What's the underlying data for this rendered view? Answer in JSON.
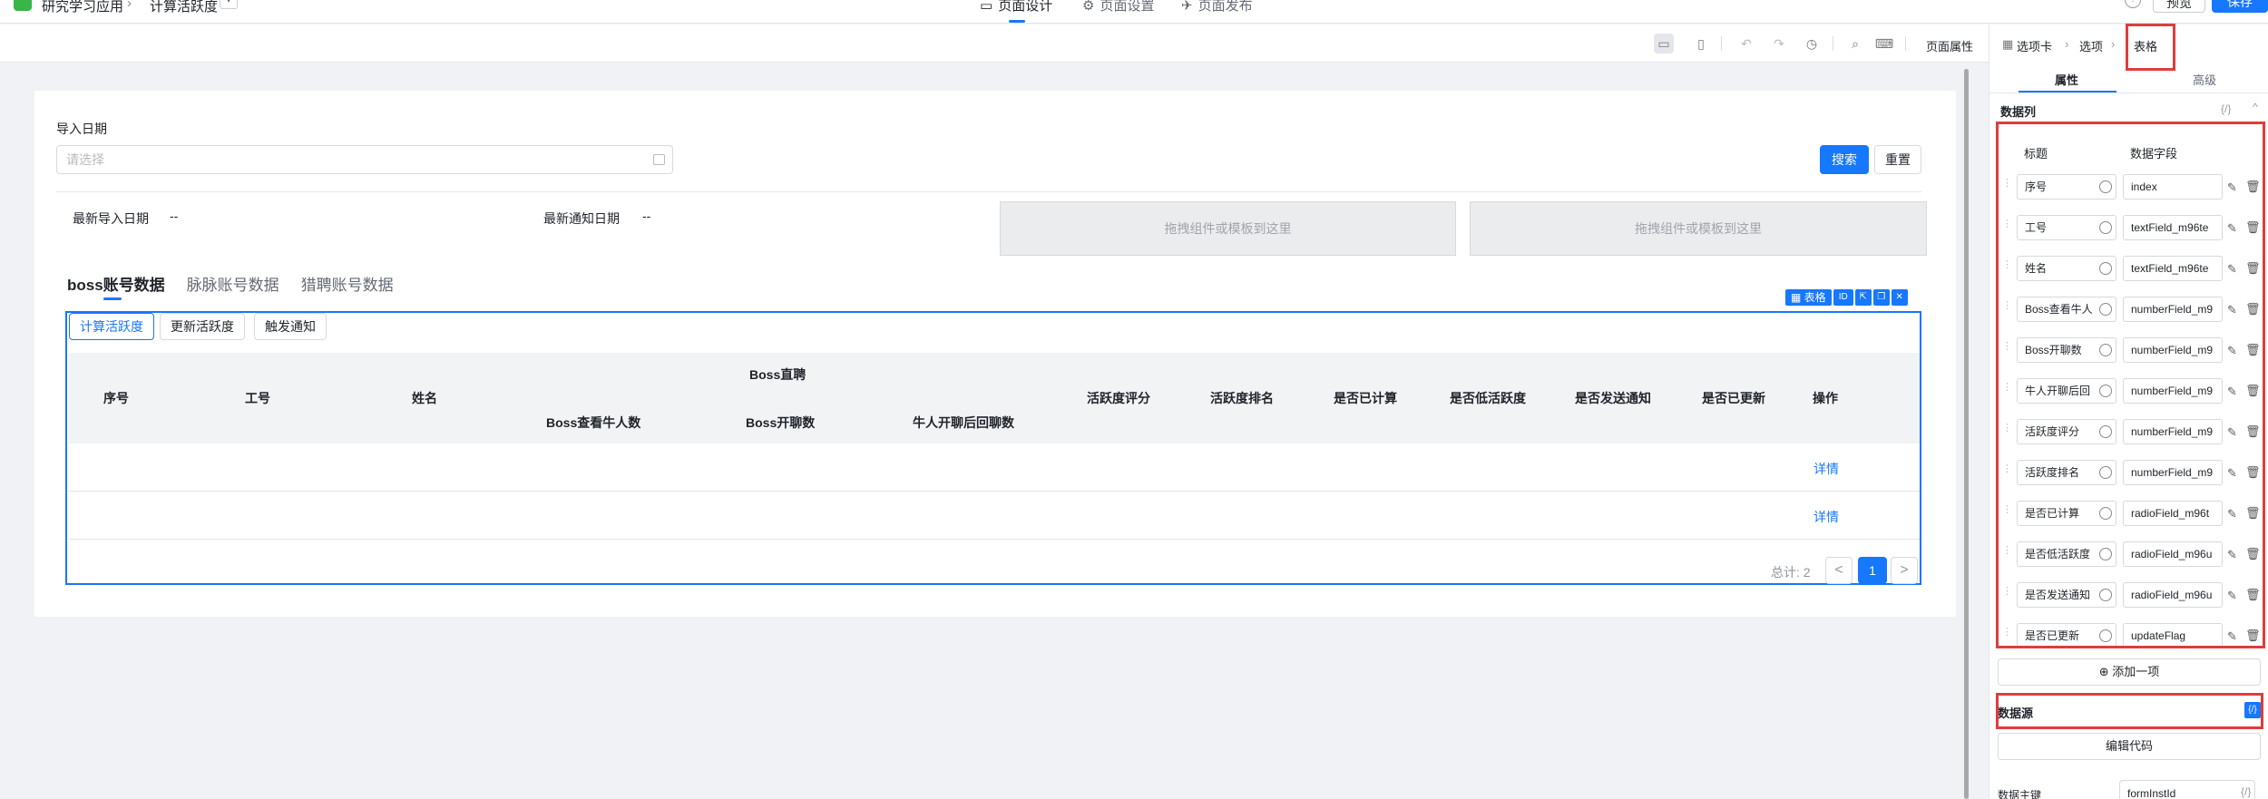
{
  "app": {
    "name": "研究学习应用",
    "page": "计算活跃度"
  },
  "top_tabs": [
    {
      "label": "页面设计"
    },
    {
      "label": "页面设置"
    },
    {
      "label": "页面发布"
    }
  ],
  "top_actions": {
    "help": "?",
    "preview": "预览",
    "save": "保存"
  },
  "toolbar": {
    "page_props": "页面属性"
  },
  "filter": {
    "label": "导入日期",
    "placeholder": "请选择",
    "search": "搜索",
    "reset": "重置"
  },
  "info": {
    "latest_import_label": "最新导入日期",
    "latest_import_value": "--",
    "latest_notify_label": "最新通知日期",
    "latest_notify_value": "--",
    "dropzone": "拖拽组件或模板到这里"
  },
  "account_tabs": [
    "boss账号数据",
    "脉脉账号数据",
    "猎聘账号数据"
  ],
  "widget": {
    "badge": "表格",
    "id_label": "ID"
  },
  "actions": [
    "计算活跃度",
    "更新活跃度",
    "触发通知"
  ],
  "table": {
    "group_header": "Boss直聘",
    "columns": [
      "序号",
      "工号",
      "姓名",
      "Boss查看牛人数",
      "Boss开聊数",
      "牛人开聊后回聊数",
      "活跃度评分",
      "活跃度排名",
      "是否已计算",
      "是否低活跃度",
      "是否发送通知",
      "是否已更新",
      "操作"
    ],
    "rows": [
      {
        "action": "详情"
      },
      {
        "action": "详情"
      }
    ],
    "total": "总计: 2",
    "page": "1",
    "prev": "<",
    "next": ">"
  },
  "right_panel": {
    "breadcrumb": [
      "选项卡",
      "选项",
      "表格"
    ],
    "tabs": [
      "属性",
      "高级"
    ],
    "section_cols": "数据列",
    "code_icon": "{/}",
    "col_title_header": "标题",
    "col_field_header": "数据字段",
    "columns": [
      {
        "title": "序号",
        "field": "index"
      },
      {
        "title": "工号",
        "field": "textField_m96te"
      },
      {
        "title": "姓名",
        "field": "textField_m96te"
      },
      {
        "title": "Boss查看牛人",
        "field": "numberField_m9"
      },
      {
        "title": "Boss开聊数",
        "field": "numberField_m9"
      },
      {
        "title": "牛人开聊后回",
        "field": "numberField_m9"
      },
      {
        "title": "活跃度评分",
        "field": "numberField_m9"
      },
      {
        "title": "活跃度排名",
        "field": "numberField_m9"
      },
      {
        "title": "是否已计算",
        "field": "radioField_m96t"
      },
      {
        "title": "是否低活跃度",
        "field": "radioField_m96u"
      },
      {
        "title": "是否发送通知",
        "field": "radioField_m96u"
      },
      {
        "title": "是否已更新",
        "field": "updateFlag"
      }
    ],
    "add_item": "添加一项",
    "datasource": "数据源",
    "edit_code": "编辑代码",
    "primary_key_label": "数据主键",
    "primary_key_value": "formInstId"
  },
  "colors": {
    "primary": "#1677ff",
    "annotation": "#e03c3c"
  }
}
